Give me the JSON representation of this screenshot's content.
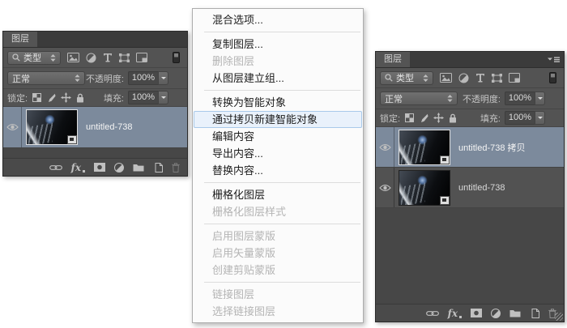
{
  "colors": {
    "panel_background": "#535353",
    "selected_layer_background": "#7c8a9c",
    "menu_background": "#fbfbfb",
    "menu_text": "#1c1c1c",
    "menu_disabled_text": "#b4b4b4",
    "menu_highlight_background": "#e9f1fb",
    "menu_highlight_border": "#a9c9ea"
  },
  "icons": {
    "filter_row": [
      "search-icon",
      "pixel-layer-filter-icon",
      "adjustment-filter-icon",
      "type-filter-icon",
      "shape-filter-icon",
      "smart-object-filter-icon",
      "filter-switch-icon"
    ],
    "lock_row": [
      "lock-transparency-icon",
      "lock-pixels-icon",
      "lock-position-icon",
      "lock-all-icon"
    ],
    "toolbar": [
      "link-layers-icon",
      "fx-layer-style",
      "add-layer-mask-icon",
      "new-adjustment-layer-icon",
      "new-group-icon",
      "new-layer-icon",
      "delete-layer-icon"
    ],
    "other": [
      "eye-icon",
      "panel-menu-icon",
      "smart-object-badge-icon",
      "updown-arrows-icon",
      "dropdown-caret-icon",
      "resize-grip"
    ]
  },
  "left_panel": {
    "tab": "图层",
    "filter_type_label": "类型",
    "blend_mode_value": "正常",
    "opacity_label": "不透明度:",
    "opacity_value": "100%",
    "lock_label": "锁定:",
    "fill_label": "填充:",
    "fill_value": "100%",
    "fx_label": "fx",
    "layers": [
      {
        "name": "untitled-738",
        "selected": true,
        "visible": true,
        "smart_object": true
      }
    ]
  },
  "right_panel": {
    "tab": "图层",
    "filter_type_label": "类型",
    "blend_mode_value": "正常",
    "opacity_label": "不透明度:",
    "opacity_value": "100%",
    "lock_label": "锁定:",
    "fill_label": "填充:",
    "fill_value": "100%",
    "fx_label": "fx",
    "layers": [
      {
        "name": "untitled-738 拷贝",
        "selected": true,
        "visible": true,
        "smart_object": true
      },
      {
        "name": "untitled-738",
        "selected": false,
        "visible": true,
        "smart_object": true
      }
    ]
  },
  "context_menu": {
    "items": [
      {
        "label": "混合选项...",
        "enabled": true
      },
      {
        "separator": true
      },
      {
        "label": "复制图层...",
        "enabled": true
      },
      {
        "label": "删除图层",
        "enabled": false
      },
      {
        "label": "从图层建立组...",
        "enabled": true
      },
      {
        "separator": true
      },
      {
        "label": "转换为智能对象",
        "enabled": true
      },
      {
        "label": "通过拷贝新建智能对象",
        "enabled": true,
        "highlighted": true
      },
      {
        "label": "编辑内容",
        "enabled": true
      },
      {
        "label": "导出内容...",
        "enabled": true
      },
      {
        "label": "替换内容...",
        "enabled": true
      },
      {
        "separator": true
      },
      {
        "label": "栅格化图层",
        "enabled": true
      },
      {
        "label": "栅格化图层样式",
        "enabled": false
      },
      {
        "separator": true
      },
      {
        "label": "启用图层蒙版",
        "enabled": false
      },
      {
        "label": "启用矢量蒙版",
        "enabled": false
      },
      {
        "label": "创建剪贴蒙版",
        "enabled": false
      },
      {
        "separator": true
      },
      {
        "label": "链接图层",
        "enabled": false
      },
      {
        "label": "选择链接图层",
        "enabled": false
      }
    ]
  }
}
